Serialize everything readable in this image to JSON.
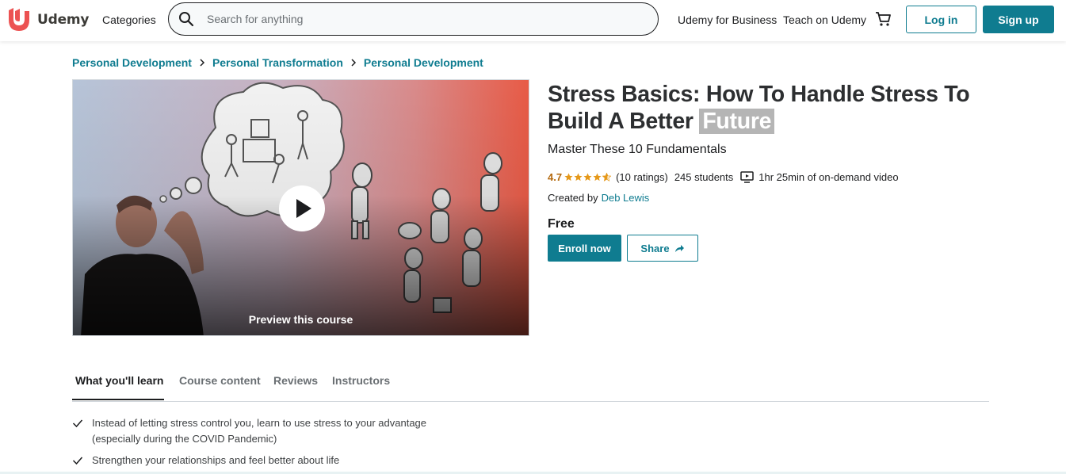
{
  "colors": {
    "accent": "#0f7c90",
    "rating": "#b4690e",
    "logo_red": "#ec5252",
    "title_highlight": "#b5b5b5"
  },
  "header": {
    "logo_text": "Udemy",
    "categories_label": "Categories",
    "search_placeholder": "Search for anything",
    "nav_business": "Udemy for Business",
    "nav_teach": "Teach on Udemy",
    "cart_icon": "cart-icon",
    "login_label": "Log in",
    "signup_label": "Sign up"
  },
  "breadcrumb": [
    "Personal Development",
    "Personal Transformation",
    "Personal Development"
  ],
  "preview": {
    "label": "Preview this course",
    "play_icon": "play-icon"
  },
  "course": {
    "title_main": "Stress Basics: How To Handle Stress To Build A Better",
    "title_highlight": "Future",
    "subtitle": "Master These 10 Fundamentals",
    "rating": "4.7",
    "stars": 4.7,
    "rating_count": "(10 ratings)",
    "students": "245 students",
    "video_length": "1hr 25min of on-demand video",
    "created_by_label": "Created by",
    "author": "Deb Lewis",
    "price": "Free",
    "enroll_label": "Enroll now",
    "share_label": "Share"
  },
  "tabs": [
    {
      "label": "What you'll learn",
      "active": true
    },
    {
      "label": "Course content",
      "active": false
    },
    {
      "label": "Reviews",
      "active": false
    },
    {
      "label": "Instructors",
      "active": false
    }
  ],
  "learn_items": [
    "Instead of letting stress control you, learn to use stress to your advantage (especially during the COVID Pandemic)",
    "Strengthen your relationships and feel better about life"
  ]
}
